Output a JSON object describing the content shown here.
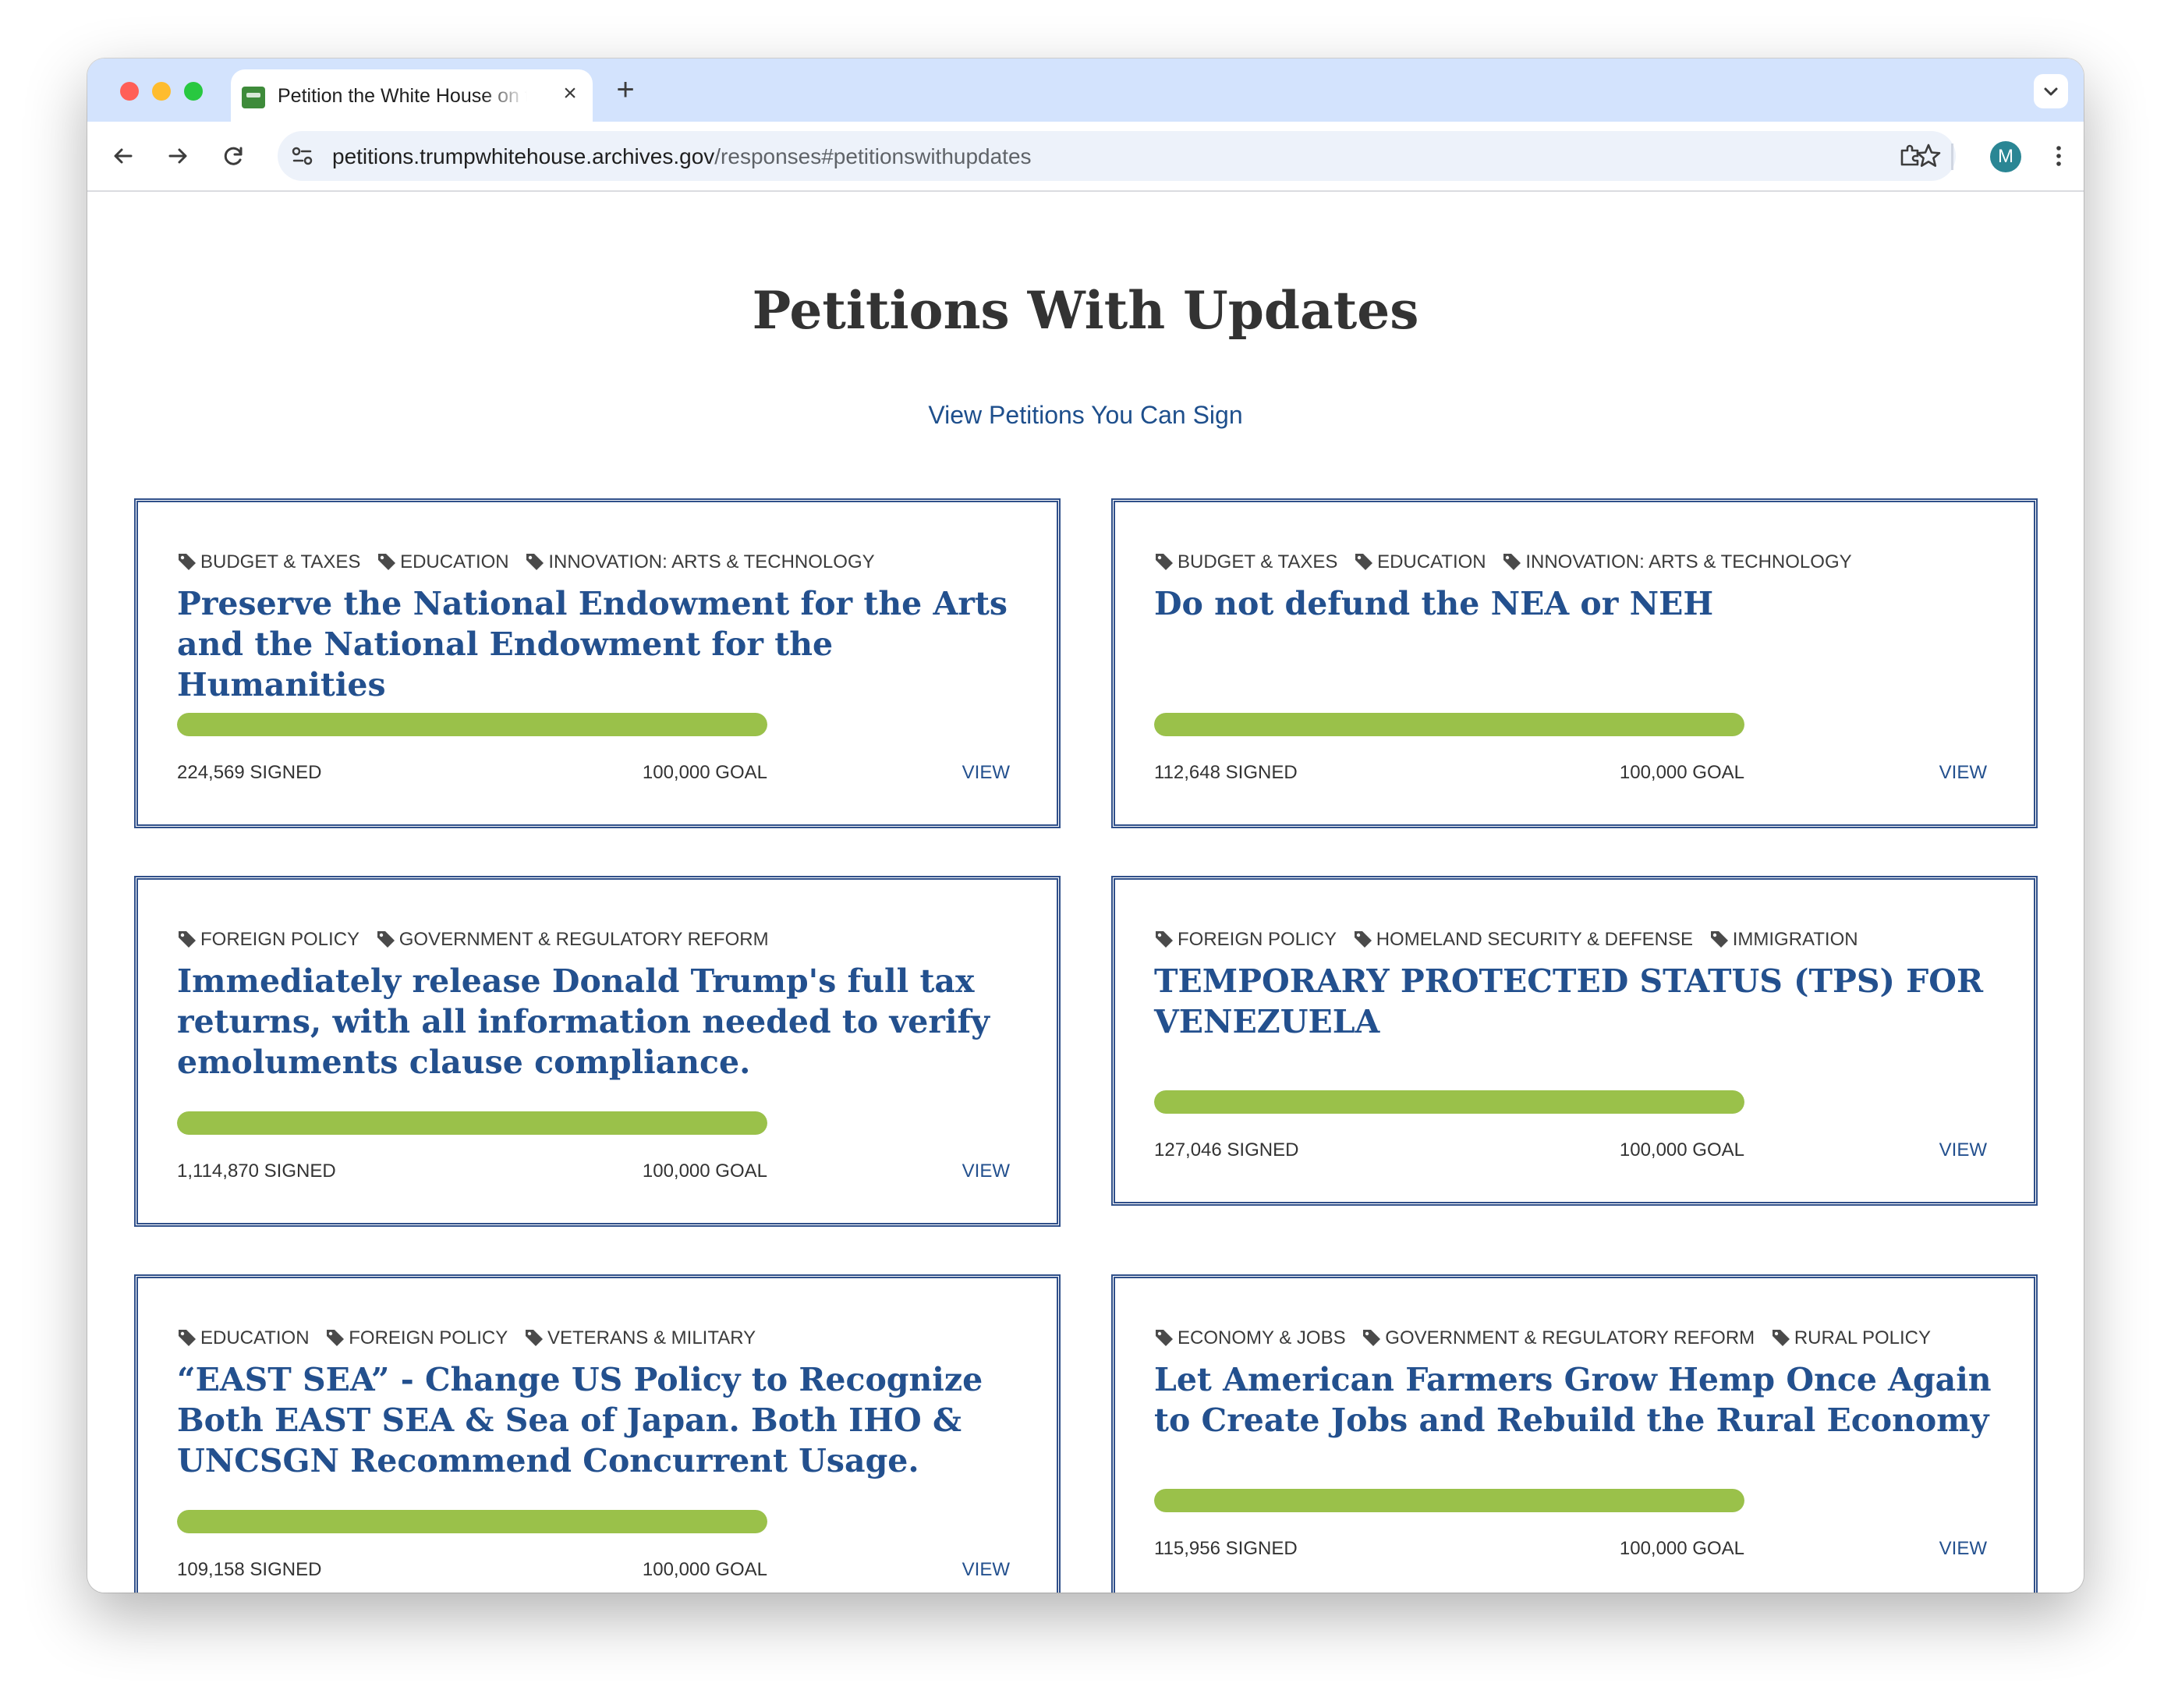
{
  "browser": {
    "tab_title": "Petition the White House on the Issues that Matter to You",
    "url_host": "petitions.trumpwhitehouse.archives.gov",
    "url_path": "/responses#petitionswithupdates",
    "profile_initial": "M",
    "icons": [
      "close-icon",
      "plus-icon",
      "chevron-down-icon",
      "back-arrow-icon",
      "forward-arrow-icon",
      "reload-icon",
      "site-settings-icon",
      "star-icon",
      "extensions-icon",
      "kebab-menu-icon"
    ]
  },
  "page": {
    "title": "Petitions With Updates",
    "sign_link": "View Petitions You Can Sign"
  },
  "petitions": [
    {
      "tags": [
        "BUDGET & TAXES",
        "EDUCATION",
        "INNOVATION: ARTS & TECHNOLOGY"
      ],
      "title": "Preserve the National Endowment for the Arts and the National Endowment for the Humanities",
      "signed": "224,569 SIGNED",
      "goal": "100,000 GOAL",
      "progress": 1.0,
      "view_label": "VIEW"
    },
    {
      "tags": [
        "BUDGET & TAXES",
        "EDUCATION",
        "INNOVATION: ARTS & TECHNOLOGY"
      ],
      "title": "Do not defund the NEA or NEH",
      "signed": "112,648 SIGNED",
      "goal": "100,000 GOAL",
      "progress": 1.0,
      "view_label": "VIEW"
    },
    {
      "tags": [
        "FOREIGN POLICY",
        "GOVERNMENT & REGULATORY REFORM"
      ],
      "title": "Immediately release Donald Trump's full tax returns, with all information needed to verify emoluments clause compliance.",
      "signed": "1,114,870 SIGNED",
      "goal": "100,000 GOAL",
      "progress": 1.0,
      "view_label": "VIEW"
    },
    {
      "tags": [
        "FOREIGN POLICY",
        "HOMELAND SECURITY & DEFENSE",
        "IMMIGRATION"
      ],
      "title": "TEMPORARY PROTECTED STATUS (TPS) FOR VENEZUELA",
      "signed": "127,046 SIGNED",
      "goal": "100,000 GOAL",
      "progress": 1.0,
      "view_label": "VIEW"
    },
    {
      "tags": [
        "EDUCATION",
        "FOREIGN POLICY",
        "VETERANS & MILITARY"
      ],
      "title": "“EAST SEA” - Change US Policy to Recognize Both EAST SEA & Sea of Japan. Both IHO & UNCSGN Recommend Concurrent Usage.",
      "signed": "109,158 SIGNED",
      "goal": "100,000 GOAL",
      "progress": 1.0,
      "view_label": "VIEW"
    },
    {
      "tags": [
        "ECONOMY & JOBS",
        "GOVERNMENT & REGULATORY REFORM",
        "RURAL POLICY"
      ],
      "title": "Let American Farmers Grow Hemp Once Again to Create Jobs and Rebuild the Rural Economy",
      "signed": "115,956 SIGNED",
      "goal": "100,000 GOAL",
      "progress": 1.0,
      "view_label": "VIEW"
    }
  ],
  "colors": {
    "link_blue": "#23508e",
    "progress_green": "#9ac14a",
    "card_border": "#30508a"
  }
}
